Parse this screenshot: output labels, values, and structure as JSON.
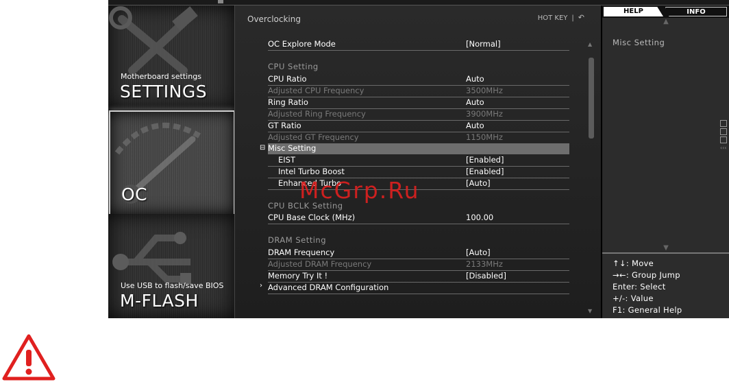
{
  "tiles": {
    "settings": {
      "small": "Motherboard settings",
      "big": "SETTINGS"
    },
    "oc": {
      "big": "OC"
    },
    "mflash": {
      "small": "Use USB to flash/save BIOS",
      "big": "M-FLASH"
    }
  },
  "main": {
    "title": "Overclocking",
    "hotkey": "HOT KEY",
    "hotkey_sep": "|",
    "oc_explore": {
      "label": "OC Explore Mode",
      "value": "[Normal]"
    },
    "cpu_section": "CPU  Setting",
    "cpu_ratio": {
      "label": "CPU Ratio",
      "value": "Auto"
    },
    "adj_cpu_freq": {
      "label": "Adjusted CPU Frequency",
      "value": "3500MHz"
    },
    "ring_ratio": {
      "label": "Ring Ratio",
      "value": "Auto"
    },
    "adj_ring_freq": {
      "label": "Adjusted Ring Frequency",
      "value": "3900MHz"
    },
    "gt_ratio": {
      "label": "GT Ratio",
      "value": "Auto"
    },
    "adj_gt_freq": {
      "label": "Adjusted GT Frequency",
      "value": "1150MHz"
    },
    "misc_expander": "⊟",
    "misc_setting": {
      "label": "Misc Setting"
    },
    "eist": {
      "label": "EIST",
      "value": "[Enabled]"
    },
    "turbo_boost": {
      "label": "Intel Turbo Boost",
      "value": "[Enabled]"
    },
    "enhanced_turbo": {
      "label": "Enhanced Turbo",
      "value": "[Auto]"
    },
    "bclk_section": "CPU  BCLK  Setting",
    "cpu_base_clock": {
      "label": "CPU Base Clock (MHz)",
      "value": "100.00"
    },
    "dram_section": "DRAM  Setting",
    "dram_freq": {
      "label": "DRAM Frequency",
      "value": "[Auto]"
    },
    "adj_dram_freq": {
      "label": "Adjusted DRAM Frequency",
      "value": "2133MHz"
    },
    "memory_try": {
      "label": "Memory Try It !",
      "value": "[Disabled]"
    },
    "adv_dram_expander": "›",
    "adv_dram": {
      "label": "Advanced DRAM Configuration"
    }
  },
  "help": {
    "tab_help": "HELP",
    "tab_info": "INFO",
    "text": "Misc  Setting",
    "keys": [
      "↑↓: Move",
      "→←: Group  Jump",
      "Enter: Select",
      "+/-: Value",
      "F1: General  Help"
    ]
  },
  "watermark": "McGrp.Ru",
  "colors": {
    "selected_row": "#6e6e6e",
    "warning": "#e0201f"
  }
}
